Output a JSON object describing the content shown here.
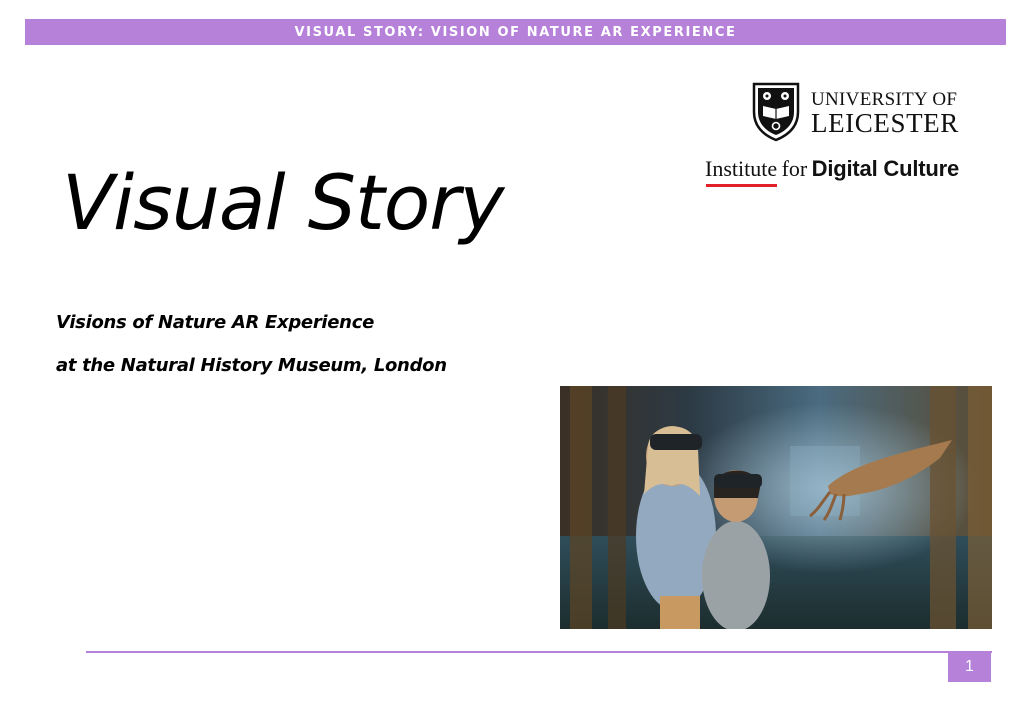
{
  "header": {
    "banner": "VISUAL STORY: VISION OF NATURE AR EXPERIENCE"
  },
  "logos": {
    "university_line1": "UNIVERSITY OF",
    "university_line2": "LEICESTER",
    "institute_part1": "Institute",
    "institute_part2": "for",
    "institute_part3": "Digital Culture"
  },
  "title": "Visual Story",
  "subtitles": [
    "Visions of Nature AR Experience",
    "at the Natural History Museum, London"
  ],
  "footer": {
    "page_number": "1"
  },
  "colors": {
    "accent": "#b581d9",
    "institute_underline": "#e2202a"
  }
}
